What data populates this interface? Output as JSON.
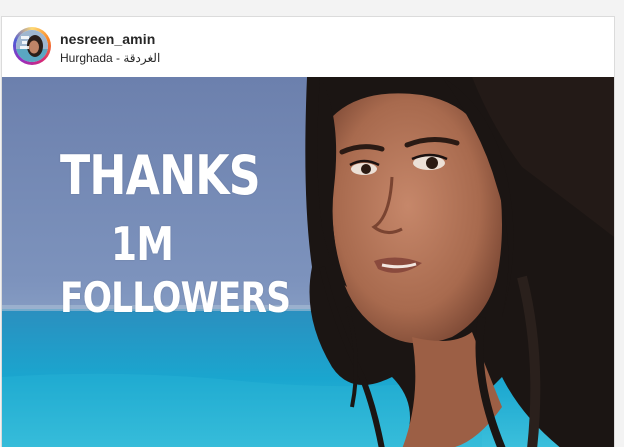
{
  "post": {
    "username": "nesreen_amin",
    "location": "Hurghada - الغردقة"
  },
  "image": {
    "overlay_lines": [
      "THANKS",
      "1M",
      "FOLLOWERS"
    ]
  },
  "colors": {
    "sky": "#6f87b5",
    "sea": "#1fa2c8",
    "text": "#ffffff",
    "hair": "#1a1412",
    "skin": "#b07256"
  }
}
